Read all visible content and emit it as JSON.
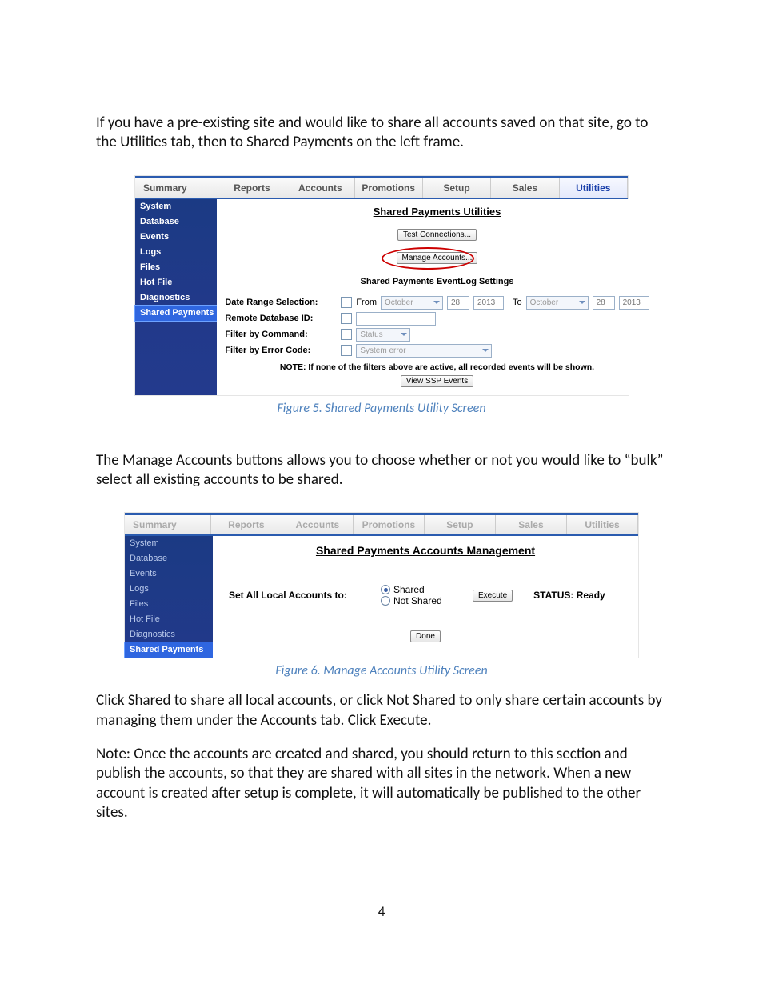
{
  "paragraphs": {
    "p1": "If you have a pre-existing site and would like to share all accounts saved on that site, go to the Utilities tab, then to Shared Payments on the left frame.",
    "p2": "The Manage Accounts buttons allows you to choose whether or not you would like to “bulk” select all existing accounts to be shared.",
    "p3": "Click Shared to share all local accounts, or click Not Shared to only share certain accounts by managing them under the Accounts tab. Click Execute.",
    "p4": "Note: Once the accounts are created and shared, you should return to this section and publish the accounts, so that they are shared with all sites in the network. When a new account is created after setup is complete, it will automatically be published to the other sites."
  },
  "captions": {
    "fig5": "Figure 5. Shared Payments Utility Screen",
    "fig6": "Figure 6. Manage Accounts Utility Screen"
  },
  "page_number": "4",
  "tabs": [
    "Summary",
    "Reports",
    "Accounts",
    "Promotions",
    "Setup",
    "Sales",
    "Utilities"
  ],
  "sidebar": {
    "items": [
      "System",
      "Database",
      "Events",
      "Logs",
      "Files",
      "Hot File",
      "Diagnostics",
      "Shared Payments"
    ]
  },
  "fig5": {
    "title": "Shared Payments Utilities",
    "btn_test": "Test Connections...",
    "btn_manage": "Manage Accounts...",
    "subhead": "Shared Payments EventLog Settings",
    "labels": {
      "date_range": "Date Range Selection:",
      "from": "From",
      "to": "To",
      "remote_db": "Remote Database ID:",
      "filter_cmd": "Filter by Command:",
      "filter_err": "Filter by Error Code:"
    },
    "values": {
      "from_month": "October",
      "from_day": "28",
      "from_year": "2013",
      "to_month": "October",
      "to_day": "28",
      "to_year": "2013",
      "cmd_placeholder": "Status",
      "err_placeholder": "System error"
    },
    "note": "NOTE: If none of the filters above are active, all recorded events will be shown.",
    "btn_view": "View SSP Events"
  },
  "fig6": {
    "title": "Shared Payments Accounts Management",
    "set_label": "Set All Local Accounts to:",
    "radio_shared": "Shared",
    "radio_notshared": "Not Shared",
    "execute": "Execute",
    "status": "STATUS: Ready",
    "done": "Done"
  }
}
